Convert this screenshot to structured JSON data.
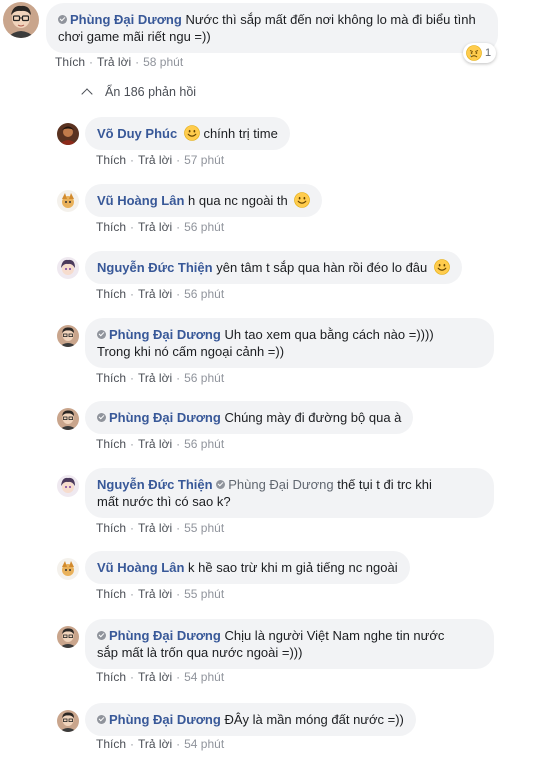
{
  "actions": {
    "like": "Thích",
    "reply": "Trả lời",
    "separator": "·"
  },
  "top_comment": {
    "author": "Phùng Đại Dương",
    "text": "Nước thì sắp mất đến nơi không lo mà đi biểu tình chơi game mãi riết ngu =))",
    "time": "58 phút",
    "reaction": {
      "icon": "sad-reaction-icon",
      "count": "1"
    }
  },
  "replies_toggle": "Ẩn 186 phản hồi",
  "replies": [
    {
      "author": "Võ Duy Phúc",
      "text": "chính trị time",
      "emoji": "smile-emoji-icon",
      "time": "57 phút"
    },
    {
      "author": "Vũ Hoàng Lân",
      "text": "h qua nc ngoài th",
      "emoji": "smile-emoji-icon",
      "time": "56 phút"
    },
    {
      "author": "Nguyễn Đức Thiện",
      "text": "yên tâm t sắp qua hàn rồi đéo lo đâu",
      "emoji": "smile-emoji-icon",
      "time": "56 phút"
    },
    {
      "author": "Phùng Đại Dương",
      "text_line1": "Uh tao xem qua bằng cách nào =))))",
      "text_line2": "Trong khi nó cấm ngoại cảnh =))",
      "time": "56 phút"
    },
    {
      "author": "Phùng Đại Dương",
      "text": "Chúng mày đi đường bộ qua à",
      "time": "56 phút"
    },
    {
      "author": "Nguyễn Đức Thiện",
      "mention": "Phùng Đại Dương",
      "text_line1": "thế tụi t đi trc khi",
      "text_line2": "mất nước thì có sao k?",
      "time": "55 phút"
    },
    {
      "author": "Vũ Hoàng Lân",
      "text": "k hề sao trừ khi m giả tiếng nc ngoài",
      "time": "55 phút"
    },
    {
      "author": "Phùng Đại Dương",
      "text_line1": "Chịu là người Việt Nam nghe tin nước",
      "text_line2": "sắp mất là trốn qua nước ngoài =)))",
      "time": "54 phút"
    },
    {
      "author": "Phùng Đại Dương",
      "text": "ĐÂy là mần móng đất nước =))",
      "time": "54 phút"
    }
  ]
}
